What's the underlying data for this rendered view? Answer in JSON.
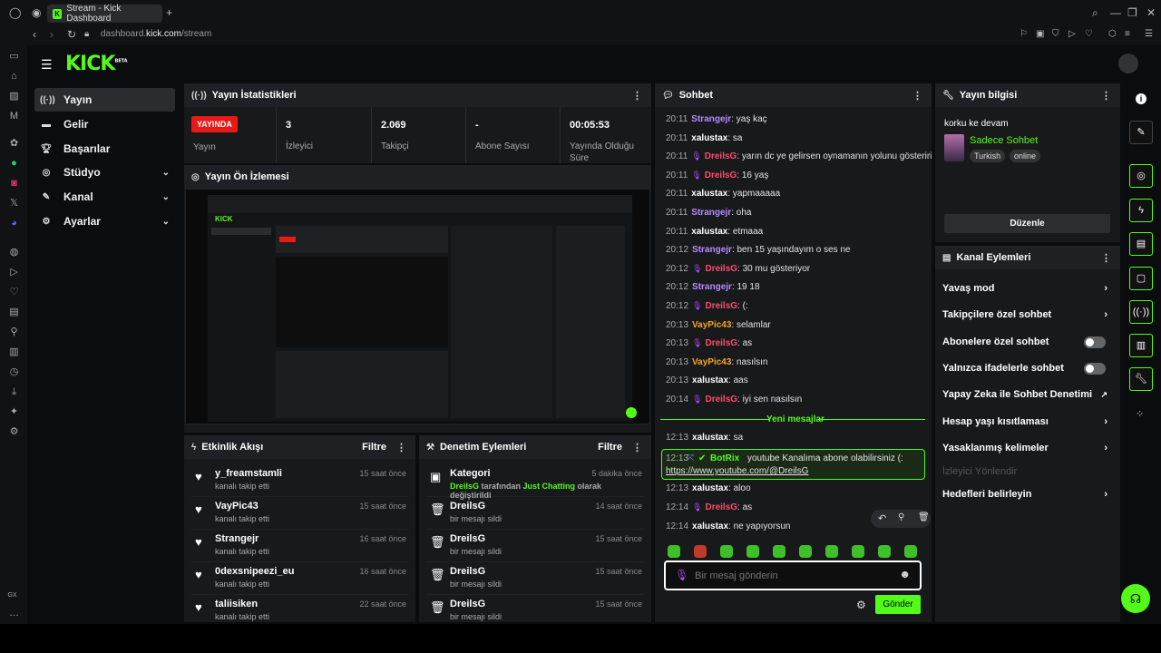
{
  "browser": {
    "tab_title": "Stream - Kick Dashboard",
    "url_prefix": "dashboard.",
    "url_domain": "kick.com",
    "url_path": "/stream",
    "gx_label": "GX"
  },
  "brand": {
    "logo": "KICK",
    "beta": "BETA",
    "accent": "#53fc18"
  },
  "nav": [
    {
      "label": "Yayın",
      "icon": "broadcast-icon"
    },
    {
      "label": "Gelir",
      "icon": "money-icon"
    },
    {
      "label": "Başarılar",
      "icon": "trophy-icon"
    },
    {
      "label": "Stüdyo",
      "icon": "studio-icon"
    },
    {
      "label": "Kanal",
      "icon": "channel-icon"
    },
    {
      "label": "Ayarlar",
      "icon": "gear-icon"
    }
  ],
  "stats": {
    "title": "Yayın İstatistikleri",
    "live": "YAYINDA",
    "live_label": "Yayın",
    "items": [
      {
        "value": "3",
        "label": "İzleyici"
      },
      {
        "value": "2.069",
        "label": "Takipçi"
      },
      {
        "value": "-",
        "label": "Abone Sayısı"
      },
      {
        "value": "00:05:53",
        "label": "Yayında Olduğu Süre"
      }
    ]
  },
  "preview": {
    "title": "Yayın Ön İzlemesi"
  },
  "activity": {
    "title": "Etkinlik Akışı",
    "filter": "Filtre",
    "events": [
      {
        "name": "y_freamstamli",
        "desc": "kanalı takip etti",
        "time": "15 saat önce"
      },
      {
        "name": "VayPic43",
        "desc": "kanalı takip etti",
        "time": "15 saat önce"
      },
      {
        "name": "Strangejr",
        "desc": "kanalı takip etti",
        "time": "16 saat önce"
      },
      {
        "name": "0dexsnipeezi_eu",
        "desc": "kanalı takip etti",
        "time": "16 saat önce"
      },
      {
        "name": "taliisiken",
        "desc": "kanalı takip etti",
        "time": "22 saat önce"
      }
    ]
  },
  "moderation": {
    "title": "Denetim Eylemleri",
    "filter": "Filtre",
    "events": [
      {
        "name": "Kategori",
        "user": "DreilsG",
        "mid": " tarafından ",
        "cat": "Just Chatting",
        "end": " olarak değiştirildi",
        "time": "5 dakika önce"
      },
      {
        "name": "DreilsG",
        "desc": "bir mesajı sildi",
        "time": "14 saat önce"
      },
      {
        "name": "DreilsG",
        "desc": "bir mesajı sildi",
        "time": "15 saat önce"
      },
      {
        "name": "DreilsG",
        "desc": "bir mesajı sildi",
        "time": "15 saat önce"
      },
      {
        "name": "DreilsG",
        "desc": "bir mesajı sildi",
        "time": "15 saat önce"
      }
    ]
  },
  "chat": {
    "title": "Sohbet",
    "new_messages": "Yeni mesajlar",
    "placeholder": "Bir mesaj gönderin",
    "send": "Gönder",
    "messages": [
      {
        "ts": "20:11",
        "user": "Strangejr",
        "color": "#b48cff",
        "badge": false,
        "text": "yaş kaç"
      },
      {
        "ts": "20:11",
        "user": "xalustax",
        "color": "#ffffff",
        "badge": false,
        "text": "sa"
      },
      {
        "ts": "20:11",
        "user": "DreilsG",
        "color": "#ff4d6d",
        "badge": true,
        "text": "yarın dc ye gelirsen oynamanın yolunu gösteririm"
      },
      {
        "ts": "20:11",
        "user": "DreilsG",
        "color": "#ff4d6d",
        "badge": true,
        "text": "16 yaş"
      },
      {
        "ts": "20:11",
        "user": "xalustax",
        "color": "#ffffff",
        "badge": false,
        "text": "yapmaaaaa"
      },
      {
        "ts": "20:11",
        "user": "Strangejr",
        "color": "#b48cff",
        "badge": false,
        "text": "oha"
      },
      {
        "ts": "20:11",
        "user": "xalustax",
        "color": "#ffffff",
        "badge": false,
        "text": "etmaaa"
      },
      {
        "ts": "20:12",
        "user": "Strangejr",
        "color": "#b48cff",
        "badge": false,
        "text": "ben 15 yaşındayım o ses ne"
      },
      {
        "ts": "20:12",
        "user": "DreilsG",
        "color": "#ff4d6d",
        "badge": true,
        "text": "30 mu gösteriyor"
      },
      {
        "ts": "20:12",
        "user": "Strangejr",
        "color": "#b48cff",
        "badge": false,
        "text": "19 18"
      },
      {
        "ts": "20:12",
        "user": "DreilsG",
        "color": "#ff4d6d",
        "badge": true,
        "text": "(:"
      },
      {
        "ts": "20:13",
        "user": "VayPic43",
        "color": "#f5a623",
        "badge": false,
        "text": "selamlar"
      },
      {
        "ts": "20:13",
        "user": "DreilsG",
        "color": "#ff4d6d",
        "badge": true,
        "text": "as"
      },
      {
        "ts": "20:13",
        "user": "VayPic43",
        "color": "#f5a623",
        "badge": false,
        "text": "nasılsın"
      },
      {
        "ts": "20:13",
        "user": "xalustax",
        "color": "#ffffff",
        "badge": false,
        "text": "aas"
      },
      {
        "ts": "20:14",
        "user": "DreilsG",
        "color": "#ff4d6d",
        "badge": true,
        "text": "iyi sen nasılsın"
      }
    ],
    "after": [
      {
        "ts": "12:13",
        "user": "xalustax",
        "color": "#ffffff",
        "badge": false,
        "text": "sa"
      },
      {
        "ts": "12:13",
        "user": "xalustax",
        "color": "#ffffff",
        "badge": false,
        "text": "aloo"
      },
      {
        "ts": "12:14",
        "user": "DreilsG",
        "color": "#ff4d6d",
        "badge": true,
        "text": "as"
      },
      {
        "ts": "12:14",
        "user": "xalustax",
        "color": "#ffffff",
        "badge": false,
        "text": "ne yapıyorsun"
      }
    ],
    "bot": {
      "ts": "12:13",
      "user": "BotRix",
      "text": "youtube Kanalıma abone olabilirsiniz (:",
      "link": "https://www.youtube.com/@DreilsG"
    }
  },
  "info": {
    "title": "Yayın bilgisi",
    "stream_title": "korku ke devam",
    "category": "Sadece Sohbet",
    "tags": [
      "Turkish",
      "online"
    ],
    "edit": "Düzenle"
  },
  "actions": {
    "title": "Kanal Eylemleri",
    "items": [
      {
        "label": "Yavaş mod",
        "kind": "arrow"
      },
      {
        "label": "Takipçilere özel sohbet",
        "kind": "arrow"
      },
      {
        "label": "Abonelere özel sohbet",
        "kind": "toggle",
        "value": "off"
      },
      {
        "label": "Yalnızca ifadelerle sohbet",
        "kind": "toggle",
        "value": "off"
      },
      {
        "label": "Yapay Zeka ile Sohbet Denetimi",
        "kind": "external"
      },
      {
        "label": "Hesap yaşı kısıtlaması",
        "kind": "arrow"
      },
      {
        "label": "Yasaklanmış kelimeler",
        "kind": "arrow"
      },
      {
        "label": "İzleyici Yönlendir",
        "kind": "disabled"
      },
      {
        "label": "Hedefleri belirleyin",
        "kind": "arrow"
      }
    ]
  }
}
